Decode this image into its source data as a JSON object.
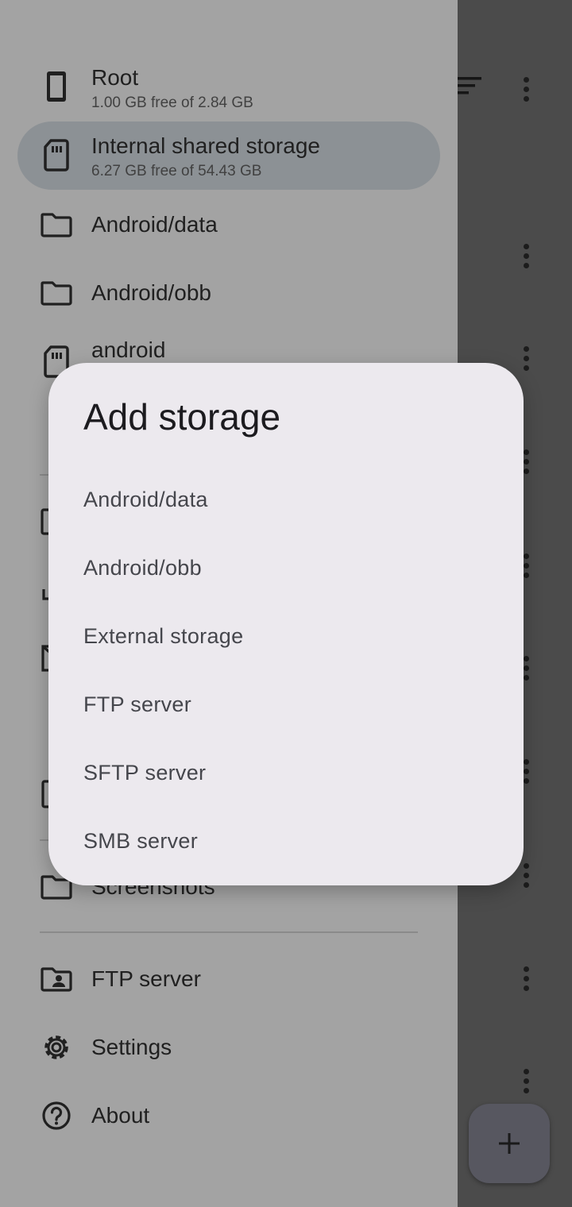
{
  "drawer": {
    "storage": [
      {
        "label": "Root",
        "sub": "1.00 GB free of 2.84 GB",
        "icon": "phone-icon"
      },
      {
        "label": "Internal shared storage",
        "sub": "6.27 GB free of 54.43 GB",
        "icon": "sd-card-icon",
        "selected": true
      },
      {
        "label": "Android/data",
        "icon": "folder-icon"
      },
      {
        "label": "Android/obb",
        "icon": "folder-icon"
      },
      {
        "label": "android",
        "icon": "sd-card-icon"
      }
    ],
    "bookmark_partial": {
      "label": "Screenshots",
      "icon": "folder-icon"
    },
    "footer": [
      {
        "label": "FTP server",
        "icon": "folder-account-icon"
      },
      {
        "label": "Settings",
        "icon": "gear-icon"
      },
      {
        "label": "About",
        "icon": "help-circle-icon"
      }
    ]
  },
  "main": {
    "toolbar_icons": [
      "sort-icon",
      "more-vert-icon"
    ],
    "fab_icon": "plus-icon"
  },
  "dialog": {
    "title": "Add storage",
    "options": [
      "Android/data",
      "Android/obb",
      "External storage",
      "FTP server",
      "SFTP server",
      "SMB server"
    ]
  }
}
